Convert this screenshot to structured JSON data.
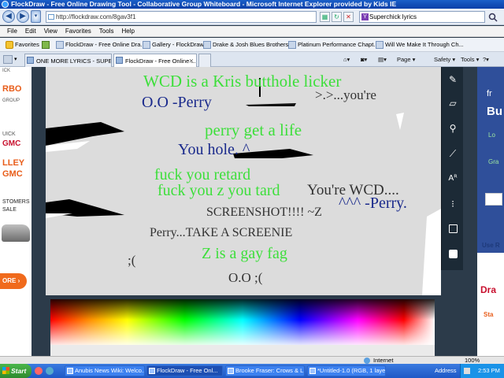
{
  "window": {
    "title": "FlockDraw - Free Online Drawing Tool - Collaborative Group Whiteboard - Microsoft Internet Explorer provided by Kids IE"
  },
  "addressbar": {
    "url": "http://flockdraw.com/8gav3f1",
    "search_value": "Superchick lyrics"
  },
  "menu": [
    "File",
    "Edit",
    "View",
    "Favorites",
    "Tools",
    "Help"
  ],
  "favorites": {
    "label": "Favorites",
    "items": [
      "FlockDraw - Free Online Dra...",
      "Gallery - FlockDraw",
      "Drake & Josh Blues Brothers ...",
      "Platinum Performance Chapt...",
      "Will We Make It Through Ch..."
    ]
  },
  "tabs": [
    {
      "label": "ONE MORE LYRICS - SUPE...",
      "active": false
    },
    {
      "label": "FlockDraw - Free Online ...",
      "active": true
    }
  ],
  "commandbar": {
    "page": "Page",
    "safety": "Safety",
    "tools": "Tools"
  },
  "left_ad": {
    "lines": [
      "ICK",
      "RBO",
      "GROUP",
      "UICK",
      "GMC",
      "LLEY",
      "GMC",
      "STOMERS",
      "SALE"
    ],
    "button": "ORE"
  },
  "right_ad": {
    "lines": [
      "fr",
      "Bu",
      "Lo",
      "Gra",
      "Use R",
      "Dra",
      "Sta"
    ]
  },
  "canvas": {
    "texts": [
      {
        "id": "t1",
        "text": "WCD is a Kris butthole licker",
        "color": "green"
      },
      {
        "id": "t2",
        "text": "O.O -Perry",
        "color": "blue"
      },
      {
        "id": "t3",
        "text": ">.>...you're",
        "color": "dark"
      },
      {
        "id": "t4",
        "text": "perry get a life",
        "color": "green"
      },
      {
        "id": "t5",
        "text": "You hole. ^",
        "color": "blue"
      },
      {
        "id": "t6",
        "text": "fuck you retard",
        "color": "green"
      },
      {
        "id": "t7",
        "text": "fuck you z you tard",
        "color": "green"
      },
      {
        "id": "t8",
        "text": "You're WCD....",
        "color": "dark"
      },
      {
        "id": "t9",
        "text": "^^^ -Perry.",
        "color": "blue"
      },
      {
        "id": "t10",
        "text": "SCREENSHOT!!!! ~Z",
        "color": "dark"
      },
      {
        "id": "t11",
        "text": "Perry...TAKE A SCREENIE",
        "color": "dark"
      },
      {
        "id": "t12",
        "text": "Z is a gay fag",
        "color": "green"
      },
      {
        "id": "t13",
        "text": ";(",
        "color": "dark"
      },
      {
        "id": "t14",
        "text": "O.O  ;(",
        "color": "dark"
      }
    ]
  },
  "toolbar_tools": [
    "pencil-icon",
    "eraser-icon",
    "fill-icon",
    "line-icon",
    "text-icon",
    "brush-size-icon",
    "save-icon",
    "color-square-icon"
  ],
  "statusbar": {
    "zone": "Internet",
    "zoom": "100%"
  },
  "taskbar": {
    "start": "Start",
    "tasks": [
      "Anubis News Wiki: Welco...",
      "FlockDraw - Free Onl...",
      "Brooke Fraser: Crows & L...",
      "*Untitled-1.0 (RGB, 1 laye..."
    ],
    "address_label": "Address",
    "clock": "2:53 PM"
  }
}
